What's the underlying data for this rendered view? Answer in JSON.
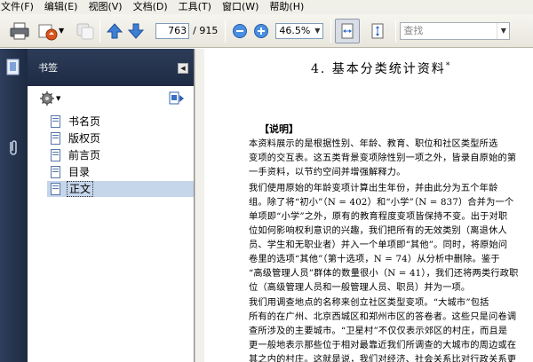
{
  "menubar": {
    "items": [
      "文件(F)",
      "编辑(E)",
      "视图(V)",
      "文档(D)",
      "工具(T)",
      "窗口(W)",
      "帮助(H)"
    ]
  },
  "toolbar": {
    "page_current": "763",
    "page_total": "/ 915",
    "zoom": "46.5%",
    "search_placeholder": "查找"
  },
  "bookmarks": {
    "title": "书签",
    "items": [
      {
        "label": "书名页"
      },
      {
        "label": "版权页"
      },
      {
        "label": "前言页"
      },
      {
        "label": "目录"
      },
      {
        "label": "正文",
        "selected": true
      }
    ]
  },
  "document": {
    "title": "4.  基本分类统计资料",
    "title_mark": "*",
    "section": "【说明】",
    "lines": [
      "    本资料展示的是根据性别、年龄、教育、职位和社区类型所选",
      "变项的交互表。这五类背景变项除性别一项之外，皆录自原始的第",
      "一手资料，以节约空间并增强解释力。",
      "    我们使用原始的年龄变项计算出生年份，并由此分为五个年龄",
      "组。除了将“初小”（N = 402）和“小学”（N = 837）合并为一个",
      "单项即“小学”之外，原有的教育程度变项皆保持不变。出于对职",
      "位如何影响权利意识的兴趣，我们把所有的无效类别（离退休人",
      "员、学生和无职业者）并入一个单项即“其他”。同时，将原始问",
      "卷里的选项“其他”（第十选项，N = 74）从分析中删除。鉴于",
      "“高级管理人员”群体的数量很小（N = 41），我们还将两类行政职",
      "位（高级管理人员和一般管理人员、职员）并为一项。",
      "    我们用调查地点的名称来创立社区类型变项。“大城市”包括",
      "所有的在广州、北京西城区和郑州市区的答卷者。这些只是问卷调",
      "查所涉及的主要城市。“卫星村”不仅仅表示郊区的村庄，而且是",
      "更一般地表示那些位于相对最靠近我们所调查的大城市的周边或在",
      "其之内的村庄。这就是说，我们对经济、社会关系比对行政关系更"
    ]
  },
  "colors": {
    "menubar_bg": "#f0efe8",
    "panel_header": "#24324d",
    "selection": "#c5d5ea"
  }
}
